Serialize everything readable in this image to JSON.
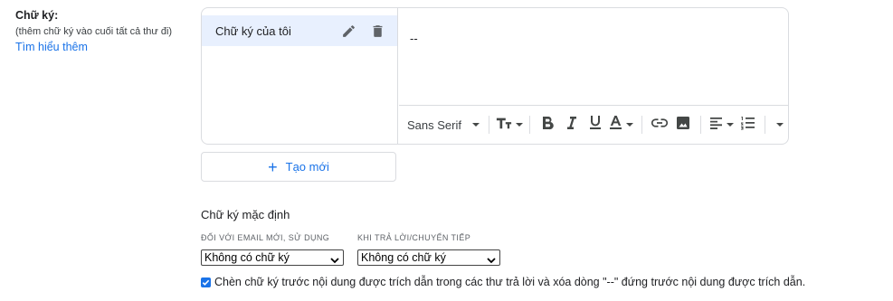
{
  "signature_section": {
    "title": "Chữ ký:",
    "subtitle": "(thêm chữ ký vào cuối tất cả thư đi)",
    "learn_more": "Tìm hiểu thêm"
  },
  "signature_list": {
    "items": [
      {
        "label": "Chữ ký của tôi",
        "selected": true
      }
    ]
  },
  "editor": {
    "content": "--"
  },
  "toolbar": {
    "font_family": "Sans Serif",
    "buttons": [
      "font-size",
      "bold",
      "italic",
      "underline",
      "text-color",
      "link",
      "image",
      "align",
      "numbered-list",
      "more"
    ]
  },
  "create_new": {
    "label": "Tạo mới"
  },
  "defaults": {
    "title": "Chữ ký mặc định",
    "new_email_label": "ĐỐI VỚI EMAIL MỚI, SỬ DỤNG",
    "new_email_value": "Không có chữ ký",
    "reply_label": "KHI TRẢ LỜI/CHUYỂN TIẾP",
    "reply_value": "Không có chữ ký"
  },
  "insert_before_quote": {
    "checked": true,
    "label": "Chèn chữ ký trước nội dung được trích dẫn trong các thư trả lời và xóa dòng \"--\" đứng trước nội dung được trích dẫn."
  },
  "colors": {
    "accent": "#1a73e8",
    "selected_bg": "#e8f0fe",
    "border": "#dadce0"
  }
}
